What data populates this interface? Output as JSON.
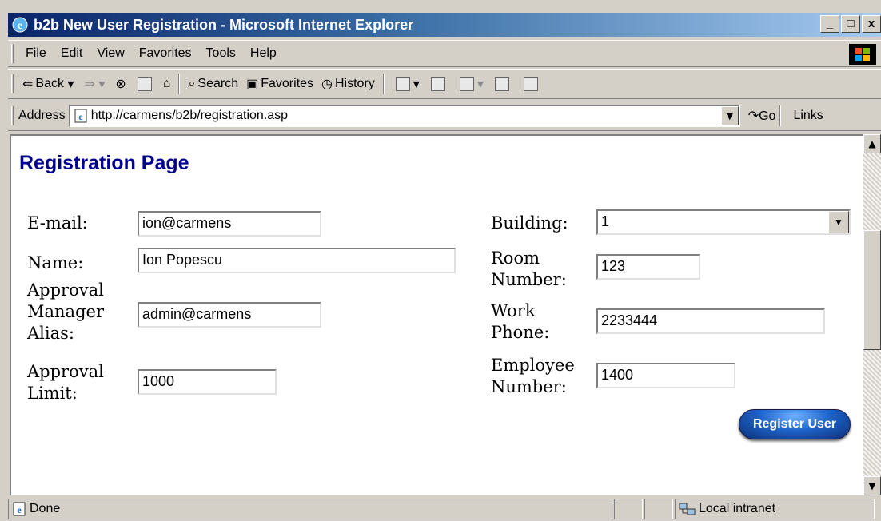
{
  "window": {
    "title": "b2b New User Registration - Microsoft Internet Explorer",
    "minimize": "_",
    "maximize": "□",
    "close": "x"
  },
  "menu": [
    "File",
    "Edit",
    "View",
    "Favorites",
    "Tools",
    "Help"
  ],
  "toolbar": {
    "back": "Back",
    "search": "Search",
    "favorites": "Favorites",
    "history": "History"
  },
  "address": {
    "label": "Address",
    "url": "http://carmens/b2b/registration.asp",
    "go": "Go",
    "links": "Links"
  },
  "page": {
    "title": "Registration Page",
    "fields": {
      "email": {
        "label": "E-mail:",
        "value": "ion@carmens"
      },
      "name": {
        "label": "Name:",
        "value": "Ion Popescu"
      },
      "approval_manager": {
        "label_lines": [
          "Approval",
          "Manager",
          "Alias:"
        ],
        "value": "admin@carmens"
      },
      "approval_limit": {
        "label_lines": [
          "Approval",
          "Limit:"
        ],
        "value": "1000"
      },
      "building": {
        "label": "Building:",
        "value": "1"
      },
      "room_number": {
        "label_lines": [
          "Room",
          "Number:"
        ],
        "value": "123"
      },
      "work_phone": {
        "label_lines": [
          "Work",
          "Phone:"
        ],
        "value": "2233444"
      },
      "employee_number": {
        "label_lines": [
          "Employee",
          "Number:"
        ],
        "value": "1400"
      }
    },
    "register_button": "Register User"
  },
  "status": {
    "text": "Done",
    "zone": "Local intranet"
  },
  "icons": {
    "ie": "ie-logo-icon",
    "page": "page-icon",
    "zone": "local-intranet-icon"
  }
}
